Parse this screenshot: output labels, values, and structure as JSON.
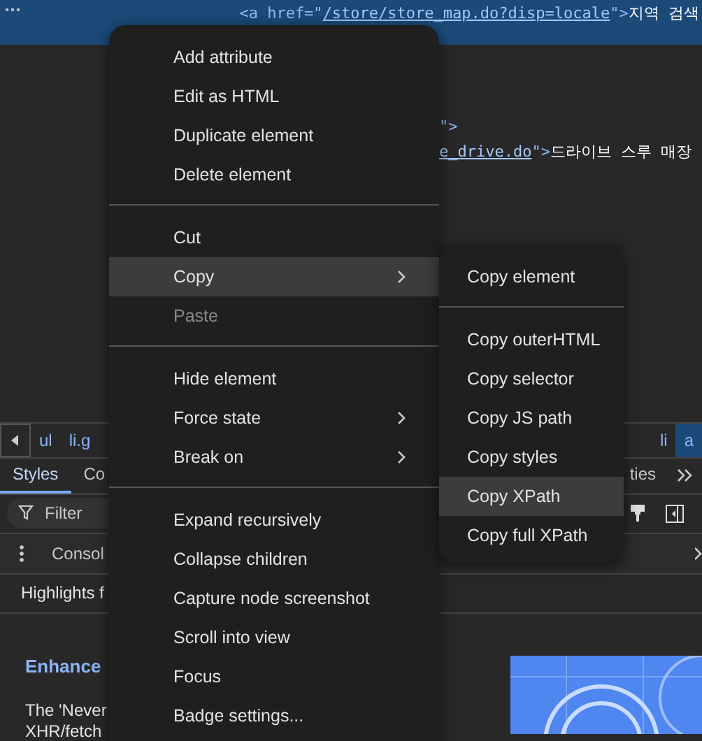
{
  "selected_line": {
    "tag_open": "<a href=\"",
    "link": "/store/store_map.do?disp=locale",
    "tag_close": "\">",
    "text": "지역 검색"
  },
  "code_lines": [
    {
      "tag_close": "\">"
    },
    {
      "link": "e_drive.do",
      "tag_close": "\">",
      "text": "드라이브 스루 매장"
    }
  ],
  "breadcrumbs": [
    {
      "label": "ul",
      "selected": false
    },
    {
      "label": "li.g",
      "selected": false
    },
    {
      "label": "li",
      "selected": false
    },
    {
      "label": "a",
      "selected": true
    }
  ],
  "tabs": [
    {
      "label": "Styles",
      "selected": true
    },
    {
      "label": "Co",
      "selected": false
    },
    {
      "label": "ties",
      "selected": false
    }
  ],
  "filter": {
    "placeholder": "Filter"
  },
  "drawer": {
    "title": "Consol",
    "line": "Highlights f"
  },
  "article": {
    "heading": "Enhance",
    "paragraph": "The 'Never",
    "paragraph_2": "XHR/fetch"
  },
  "context_menu": {
    "groups": [
      [
        {
          "label": "Add attribute",
          "submenu": false,
          "disabled": false,
          "selected": false
        },
        {
          "label": "Edit as HTML",
          "submenu": false,
          "disabled": false,
          "selected": false
        },
        {
          "label": "Duplicate element",
          "submenu": false,
          "disabled": false,
          "selected": false
        },
        {
          "label": "Delete element",
          "submenu": false,
          "disabled": false,
          "selected": false
        }
      ],
      [
        {
          "label": "Cut",
          "submenu": false,
          "disabled": false,
          "selected": false
        },
        {
          "label": "Copy",
          "submenu": true,
          "disabled": false,
          "selected": true
        },
        {
          "label": "Paste",
          "submenu": false,
          "disabled": true,
          "selected": false
        }
      ],
      [
        {
          "label": "Hide element",
          "submenu": false,
          "disabled": false,
          "selected": false
        },
        {
          "label": "Force state",
          "submenu": true,
          "disabled": false,
          "selected": false
        },
        {
          "label": "Break on",
          "submenu": true,
          "disabled": false,
          "selected": false
        }
      ],
      [
        {
          "label": "Expand recursively",
          "submenu": false,
          "disabled": false,
          "selected": false
        },
        {
          "label": "Collapse children",
          "submenu": false,
          "disabled": false,
          "selected": false
        },
        {
          "label": "Capture node screenshot",
          "submenu": false,
          "disabled": false,
          "selected": false
        },
        {
          "label": "Scroll into view",
          "submenu": false,
          "disabled": false,
          "selected": false
        },
        {
          "label": "Focus",
          "submenu": false,
          "disabled": false,
          "selected": false
        },
        {
          "label": "Badge settings...",
          "submenu": false,
          "disabled": false,
          "selected": false
        }
      ]
    ]
  },
  "copy_submenu": {
    "groups": [
      [
        {
          "label": "Copy element",
          "submenu": false,
          "disabled": false,
          "selected": false
        }
      ],
      [
        {
          "label": "Copy outerHTML",
          "submenu": false,
          "disabled": false,
          "selected": false
        },
        {
          "label": "Copy selector",
          "submenu": false,
          "disabled": false,
          "selected": false
        },
        {
          "label": "Copy JS path",
          "submenu": false,
          "disabled": false,
          "selected": false
        },
        {
          "label": "Copy styles",
          "submenu": false,
          "disabled": false,
          "selected": false
        },
        {
          "label": "Copy XPath",
          "submenu": false,
          "disabled": false,
          "selected": true
        },
        {
          "label": "Copy full XPath",
          "submenu": false,
          "disabled": false,
          "selected": false
        }
      ]
    ]
  }
}
